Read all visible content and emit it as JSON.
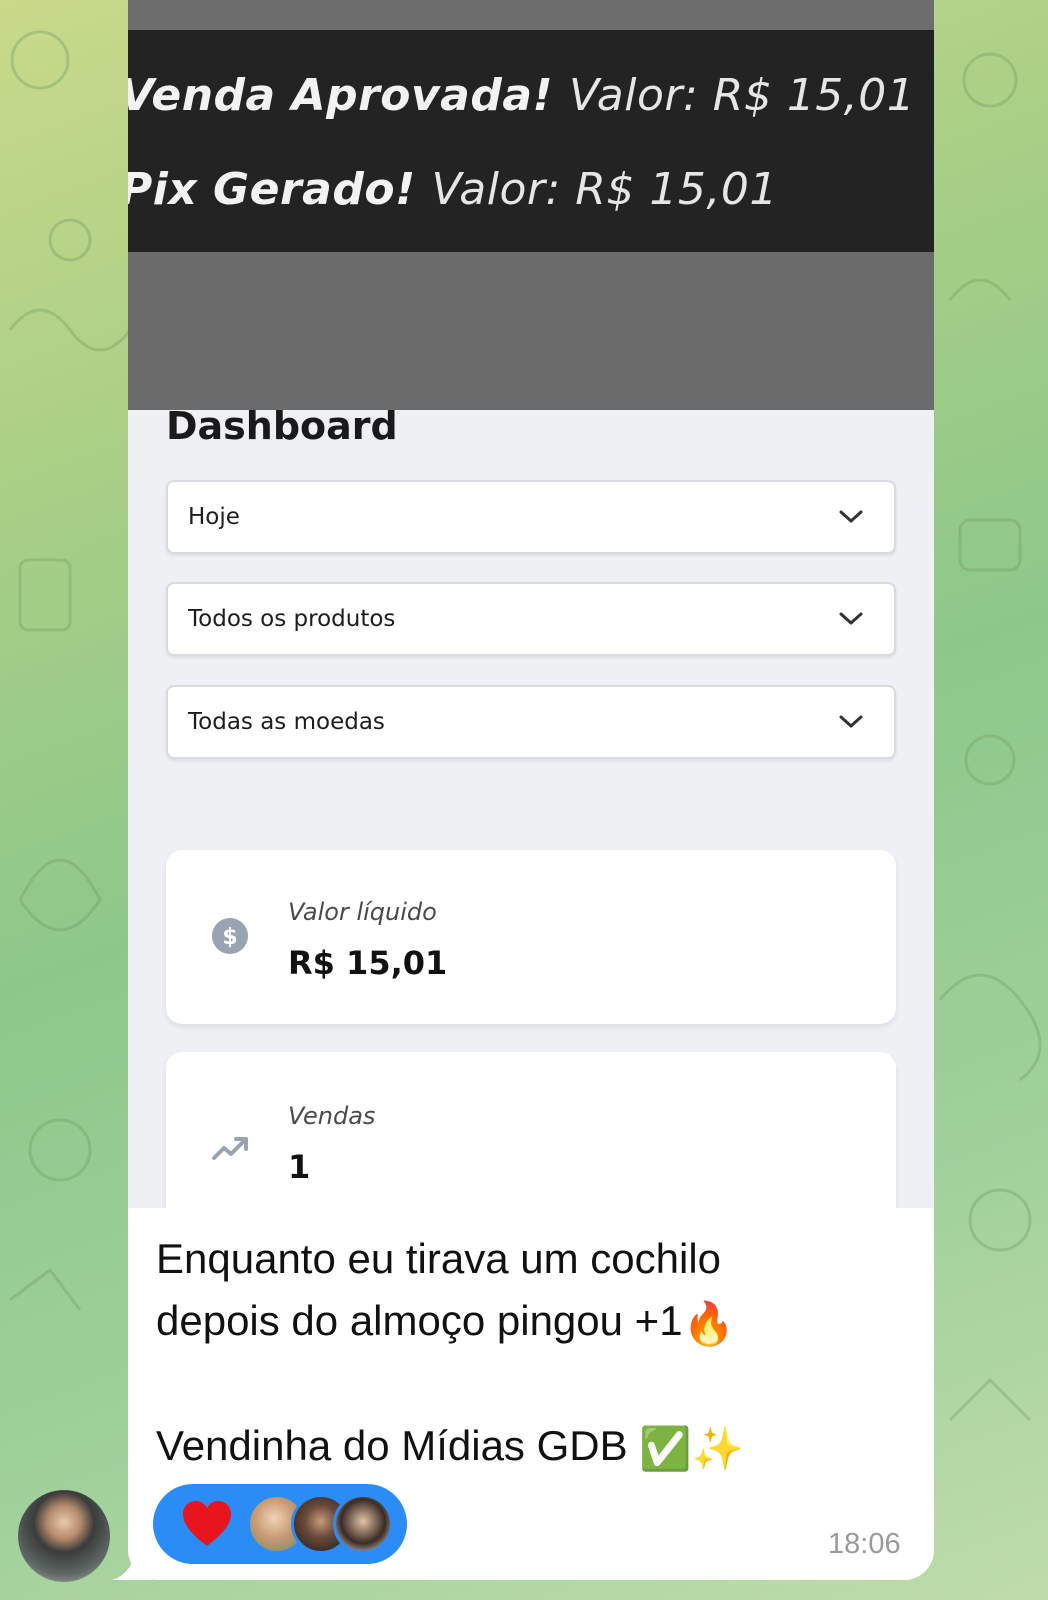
{
  "notifications": {
    "line1_title": "Venda Aprovada!",
    "line1_value": "Valor: R$ 15,01",
    "line2_title": "Pix Gerado!",
    "line2_value": "Valor: R$ 15,01"
  },
  "dashboard": {
    "title": "Dashboard",
    "filters": [
      {
        "label": "Hoje"
      },
      {
        "label": "Todos os produtos"
      },
      {
        "label": "Todas as moedas"
      }
    ],
    "cards": [
      {
        "label": "Valor líquido",
        "value": "R$ 15,01",
        "icon": "dollar-icon"
      },
      {
        "label": "Vendas",
        "value": "1",
        "icon": "trending-up-icon"
      }
    ]
  },
  "message": {
    "line1": "Enquanto eu tirava um cochilo",
    "line2": "depois do almoço pingou +1",
    "line2_emoji": "🔥",
    "line3": "Vendinha do Mídias GDB",
    "line3_emoji_check": "✅",
    "line3_emoji_sparkles": "✨",
    "time": "18:06"
  },
  "reactions": {
    "emoji": "heart",
    "avatars": 3
  },
  "colors": {
    "reaction_bg": "#2b8cf6",
    "notif_bg": "#232323",
    "heart": "#e8141e"
  }
}
